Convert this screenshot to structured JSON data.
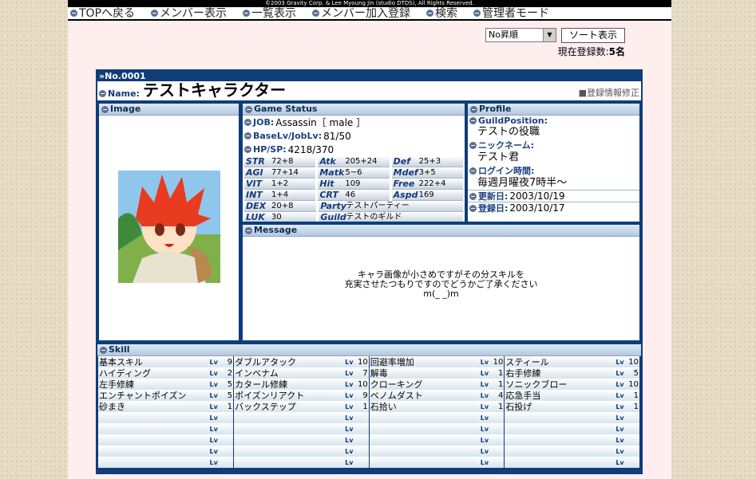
{
  "copyright": "©2003 Gravity Corp. & Lee Myoung Jin (studio DTDS), All Rights Reserved.",
  "nav": [
    "TOPへ戻る",
    "メンバー表示",
    "一覧表示",
    "メンバー加入登録",
    "検索",
    "管理者モード"
  ],
  "sort": {
    "selected": "No昇順",
    "button": "ソート表示"
  },
  "count": {
    "label": "現在登録数:",
    "value": "5名"
  },
  "card": {
    "no": "No.0001",
    "name_label": "Name:",
    "name": "テストキャラクター",
    "edit": "■登録情報修正",
    "image_header": "Image",
    "game_header": "Game Status",
    "profile_header": "Profile",
    "message_header": "Message",
    "skill_header": "Skill"
  },
  "status": {
    "job_label": "JOB:",
    "job": "Assassin［ male ］",
    "lv_label": "BaseLv/JobLv:",
    "lv": "81/50",
    "hpsp_label": "HP/SP:",
    "hpsp": "4218/370",
    "stats": [
      {
        "n": "STR",
        "v": "72+8"
      },
      {
        "n": "Atk",
        "v": "205+24"
      },
      {
        "n": "Def",
        "v": "25+3"
      },
      {
        "n": "AGI",
        "v": "77+14"
      },
      {
        "n": "Matk",
        "v": "5~6"
      },
      {
        "n": "Mdef",
        "v": "3+5"
      },
      {
        "n": "VIT",
        "v": "1+2"
      },
      {
        "n": "Hit",
        "v": "109"
      },
      {
        "n": "Free",
        "v": "222+4"
      },
      {
        "n": "INT",
        "v": "1+4"
      },
      {
        "n": "CRT",
        "v": "46"
      },
      {
        "n": "Aspd",
        "v": "169"
      }
    ],
    "dex_label": "DEX",
    "dex": "20+8",
    "party_label": "Party",
    "party": "テストパーティー",
    "luk_label": "LUK",
    "luk": "30",
    "guild_label": "Guild",
    "guild": "テストのギルド"
  },
  "profile": {
    "gp_label": "GuildPosition:",
    "gp": "テストの役職",
    "nick_label": "ニックネーム:",
    "nick": "テスト君",
    "login_label": "ログイン時間:",
    "login": "毎週月曜夜7時半～",
    "updated_label": "更新日:",
    "updated": "2003/10/19",
    "registered_label": "登録日:",
    "registered": "2003/10/17"
  },
  "message": [
    "キャラ画像が小さめですがその分スキルを",
    "充実させたつもりですのでどうかご了承ください",
    "m(_ _)m"
  ],
  "lv_label": "Lv",
  "skills": [
    [
      {
        "n": "基本スキル",
        "l": "9"
      },
      {
        "n": "ダブルアタック",
        "l": "10"
      },
      {
        "n": "回避率増加",
        "l": "10"
      },
      {
        "n": "スティール",
        "l": "10"
      }
    ],
    [
      {
        "n": "ハイディング",
        "l": "2"
      },
      {
        "n": "インベナム",
        "l": "7"
      },
      {
        "n": "解毒",
        "l": "1"
      },
      {
        "n": "右手修練",
        "l": "5"
      }
    ],
    [
      {
        "n": "左手修練",
        "l": "5"
      },
      {
        "n": "カタール修練",
        "l": "10"
      },
      {
        "n": "クローキング",
        "l": "1"
      },
      {
        "n": "ソニックブロー",
        "l": "10"
      }
    ],
    [
      {
        "n": "エンチャントポイズン",
        "l": "5"
      },
      {
        "n": "ポイズンリアクト",
        "l": "9"
      },
      {
        "n": "ベノムダスト",
        "l": "4"
      },
      {
        "n": "応急手当",
        "l": "1"
      }
    ],
    [
      {
        "n": "砂まき",
        "l": "1"
      },
      {
        "n": "バックステップ",
        "l": "1"
      },
      {
        "n": "石拾い",
        "l": "1"
      },
      {
        "n": "石投げ",
        "l": "1"
      }
    ],
    [
      {
        "n": "",
        "l": ""
      },
      {
        "n": "",
        "l": ""
      },
      {
        "n": "",
        "l": ""
      },
      {
        "n": "",
        "l": ""
      }
    ],
    [
      {
        "n": "",
        "l": ""
      },
      {
        "n": "",
        "l": ""
      },
      {
        "n": "",
        "l": ""
      },
      {
        "n": "",
        "l": ""
      }
    ],
    [
      {
        "n": "",
        "l": ""
      },
      {
        "n": "",
        "l": ""
      },
      {
        "n": "",
        "l": ""
      },
      {
        "n": "",
        "l": ""
      }
    ],
    [
      {
        "n": "",
        "l": ""
      },
      {
        "n": "",
        "l": ""
      },
      {
        "n": "",
        "l": ""
      },
      {
        "n": "",
        "l": ""
      }
    ],
    [
      {
        "n": "",
        "l": ""
      },
      {
        "n": "",
        "l": ""
      },
      {
        "n": "",
        "l": ""
      },
      {
        "n": "",
        "l": ""
      }
    ]
  ]
}
